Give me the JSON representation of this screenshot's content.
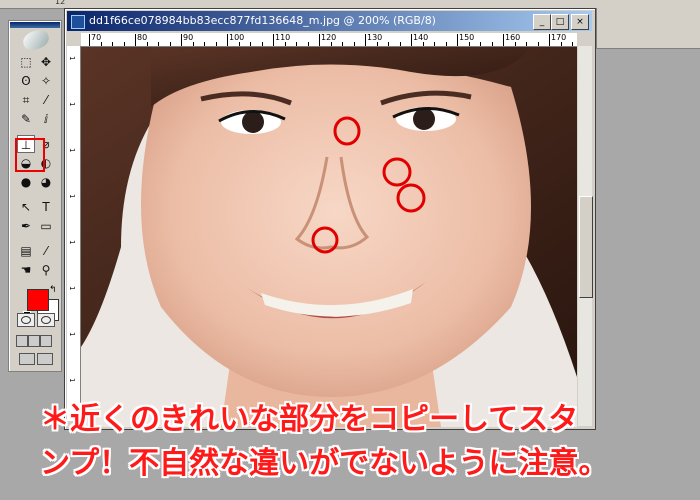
{
  "options_bar": {
    "value": "12"
  },
  "document": {
    "title": "dd1f66ce078984bb83ecc877fd136648_m.jpg @ 200% (RGB/8)",
    "buttons": {
      "minimize": "_",
      "restore": "□",
      "close": "×"
    },
    "ruler_top_labels": [
      "70",
      "80",
      "90",
      "100",
      "110",
      "120",
      "130",
      "140",
      "150",
      "160",
      "170"
    ],
    "ruler_left_labels": [
      "1",
      "1",
      "1",
      "1",
      "1",
      "1",
      "1",
      "1"
    ]
  },
  "toolbox": {
    "tools": [
      {
        "name": "marquee-tool",
        "glyph": "⬚"
      },
      {
        "name": "move-tool",
        "glyph": "✥"
      },
      {
        "name": "lasso-tool",
        "glyph": "ʘ"
      },
      {
        "name": "magic-wand-tool",
        "glyph": "✧"
      },
      {
        "name": "crop-tool",
        "glyph": "⌗"
      },
      {
        "name": "slice-tool",
        "glyph": "⁄"
      },
      {
        "name": "healing-brush-tool",
        "glyph": "✎"
      },
      {
        "name": "brush-tool",
        "glyph": "ⅈ"
      },
      {
        "name": "clone-stamp-tool",
        "glyph": "⊥"
      },
      {
        "name": "history-brush-tool",
        "glyph": "⌀"
      },
      {
        "name": "eraser-tool",
        "glyph": "◒"
      },
      {
        "name": "gradient-tool",
        "glyph": "◐"
      },
      {
        "name": "blur-tool",
        "glyph": "●"
      },
      {
        "name": "dodge-tool",
        "glyph": "◕"
      },
      {
        "name": "path-select-tool",
        "glyph": "↖"
      },
      {
        "name": "type-tool",
        "glyph": "T"
      },
      {
        "name": "pen-tool",
        "glyph": "✒"
      },
      {
        "name": "shape-tool",
        "glyph": "▭"
      },
      {
        "name": "notes-tool",
        "glyph": "▤"
      },
      {
        "name": "eyedropper-tool",
        "glyph": "⁄"
      },
      {
        "name": "hand-tool",
        "glyph": "☚"
      },
      {
        "name": "zoom-tool",
        "glyph": "⚲"
      }
    ],
    "foreground_color": "#ff0000",
    "background_color": "#ffffff"
  },
  "caption": {
    "line1": "＊近くのきれいな部分をコピーしてスタ",
    "line2": "ンプ！不自然な違いがでないように注意。"
  },
  "markers_color": "#e00000"
}
